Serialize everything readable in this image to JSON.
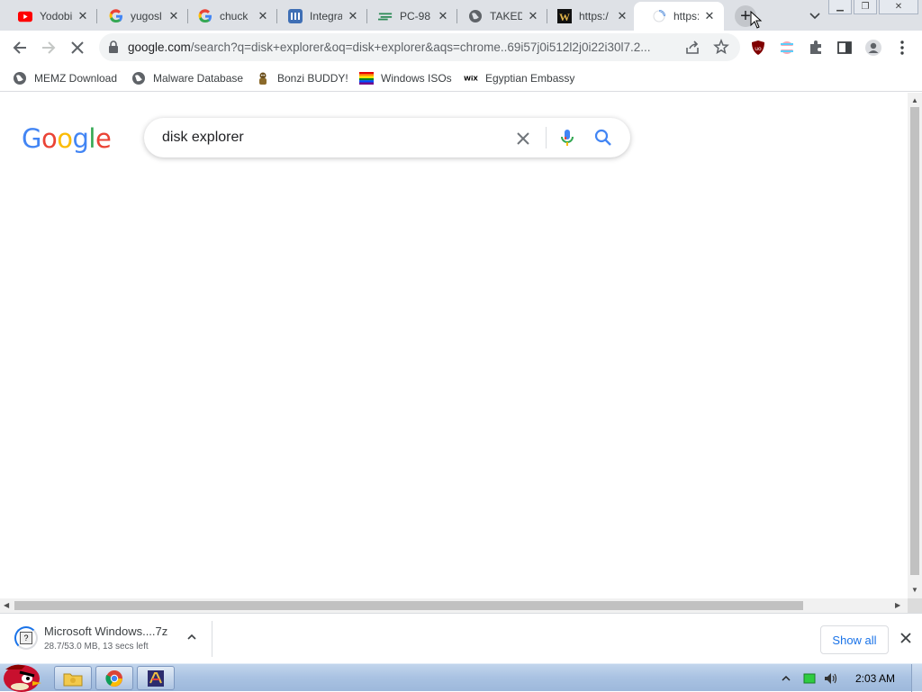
{
  "tabs": [
    {
      "title": "Yodobi",
      "icon": "youtube-icon"
    },
    {
      "title": "yugosl",
      "icon": "google-icon"
    },
    {
      "title": "chuck",
      "icon": "google-icon"
    },
    {
      "title": "Integra",
      "icon": "site-icon"
    },
    {
      "title": "PC-98",
      "icon": "site-icon"
    },
    {
      "title": "TAKED",
      "icon": "globe-icon"
    },
    {
      "title": "https:/",
      "icon": "w-icon"
    },
    {
      "title": "https:/",
      "icon": "loading-spinner-icon",
      "active": true
    }
  ],
  "omnibox": {
    "url_host": "google.com",
    "url_rest": "/search?q=disk+explorer&oq=disk+explorer&aqs=chrome..69i57j0i512l2j0i22i30l7.2..."
  },
  "bookmarks": [
    {
      "label": "MEMZ Download",
      "icon": "globe-icon"
    },
    {
      "label": "Malware Database",
      "icon": "globe-icon"
    },
    {
      "label": "Bonzi BUDDY!",
      "icon": "bonzi-icon"
    },
    {
      "label": "Windows ISOs",
      "icon": "rainbow-flag-icon"
    },
    {
      "label": "Egyptian Embassy",
      "icon": "wix-icon"
    }
  ],
  "google": {
    "logo": [
      "G",
      "o",
      "o",
      "g",
      "l",
      "e"
    ],
    "logo_colors": [
      "#4285f4",
      "#ea4335",
      "#fbbc05",
      "#4285f4",
      "#34a853",
      "#ea4335"
    ],
    "query": "disk explorer"
  },
  "download": {
    "filename": "Microsoft Windows....7z",
    "status": "28.7/53.0 MB, 13 secs left",
    "show_all": "Show all"
  },
  "taskbar": {
    "clock": "2:03 AM"
  }
}
